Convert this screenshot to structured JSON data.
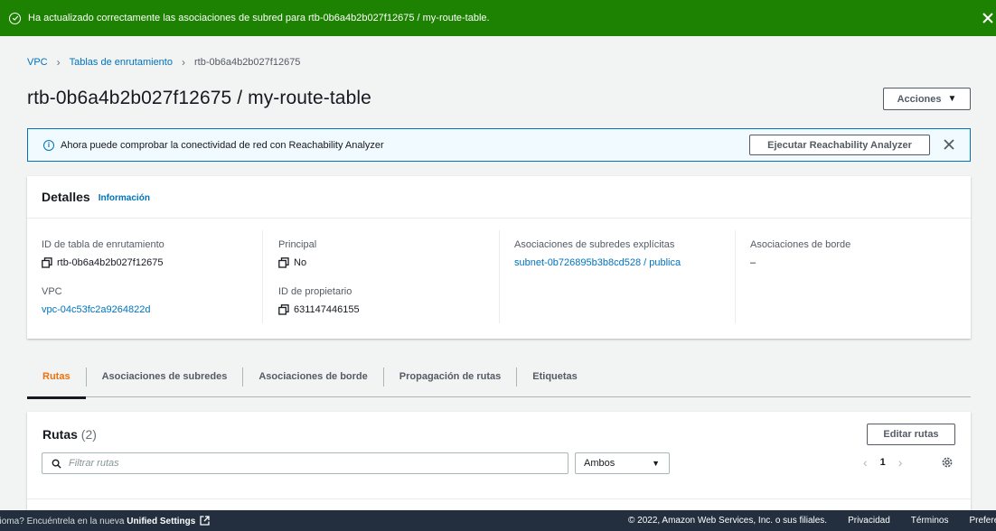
{
  "flash": {
    "message": "Ha actualizado correctamente las asociaciones de subred para rtb-0b6a4b2b027f12675 / my-route-table."
  },
  "breadcrumb": {
    "items": [
      "VPC",
      "Tablas de enrutamiento"
    ],
    "current": "rtb-0b6a4b2b027f12675"
  },
  "page": {
    "title": "rtb-0b6a4b2b027f12675 / my-route-table",
    "actions_label": "Acciones"
  },
  "info_banner": {
    "text": "Ahora puede comprobar la conectividad de red con Reachability Analyzer",
    "button_label": "Ejecutar Reachability Analyzer"
  },
  "details": {
    "heading": "Detalles",
    "info_link": "Información",
    "route_table_id_label": "ID de tabla de enrutamiento",
    "route_table_id": "rtb-0b6a4b2b027f12675",
    "vpc_label": "VPC",
    "vpc_id": "vpc-04c53fc2a9264822d",
    "main_label": "Principal",
    "main_value": "No",
    "owner_label": "ID de propietario",
    "owner_id": "631147446155",
    "subnet_assoc_label": "Asociaciones de subredes explícitas",
    "subnet_assoc_value": "subnet-0b726895b3b8cd528 / publica",
    "edge_assoc_label": "Asociaciones de borde",
    "edge_assoc_value": "–"
  },
  "tabs": [
    "Rutas",
    "Asociaciones de subredes",
    "Asociaciones de borde",
    "Propagación de rutas",
    "Etiquetas"
  ],
  "routes": {
    "heading": "Rutas",
    "count": "(2)",
    "edit_label": "Editar rutas",
    "filter_placeholder": "Filtrar rutas",
    "filter_select": "Ambos",
    "page": "1"
  },
  "footer": {
    "lang_prefix": "dioma? Encuéntrela en la nueva",
    "unified_settings": "Unified Settings",
    "copyright": "© 2022, Amazon Web Services, Inc. o sus filiales.",
    "privacy": "Privacidad",
    "terms": "Términos",
    "prefs": "Preferencias"
  },
  "colors": {
    "success": "#1d8102",
    "link": "#0073bb",
    "active_tab": "#ec7211",
    "footer_bg": "#232f3e"
  }
}
